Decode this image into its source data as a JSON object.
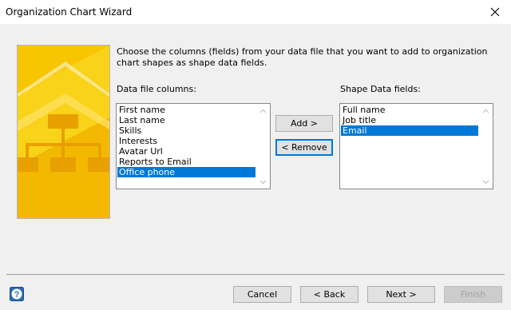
{
  "window": {
    "title": "Organization Chart Wizard"
  },
  "instructions": "Choose the columns (fields) from your data file that you want to add to organization chart shapes as shape data fields.",
  "data_file_columns": {
    "label": "Data file columns:",
    "items": [
      {
        "label": "First name"
      },
      {
        "label": "Last name"
      },
      {
        "label": "Skills"
      },
      {
        "label": "Interests"
      },
      {
        "label": "Avatar Url"
      },
      {
        "label": "Reports to Email"
      },
      {
        "label": "Office phone"
      }
    ],
    "selected": "Office phone"
  },
  "shape_data_fields": {
    "label": "Shape Data fields:",
    "items": [
      {
        "label": "Full name"
      },
      {
        "label": "Job title"
      },
      {
        "label": "Email"
      }
    ],
    "selected": "Email"
  },
  "buttons": {
    "add": "Add >",
    "remove": "< Remove",
    "cancel": "Cancel",
    "back": "< Back",
    "next": "Next >",
    "finish": "Finish"
  },
  "colors": {
    "selection": "#0078d7",
    "banner_yellow": "#f7c600",
    "banner_orange": "#f0a800"
  },
  "icons": [
    "close-icon",
    "help-icon",
    "scroll-up-icon",
    "scroll-down-icon",
    "org-chart-banner"
  ]
}
